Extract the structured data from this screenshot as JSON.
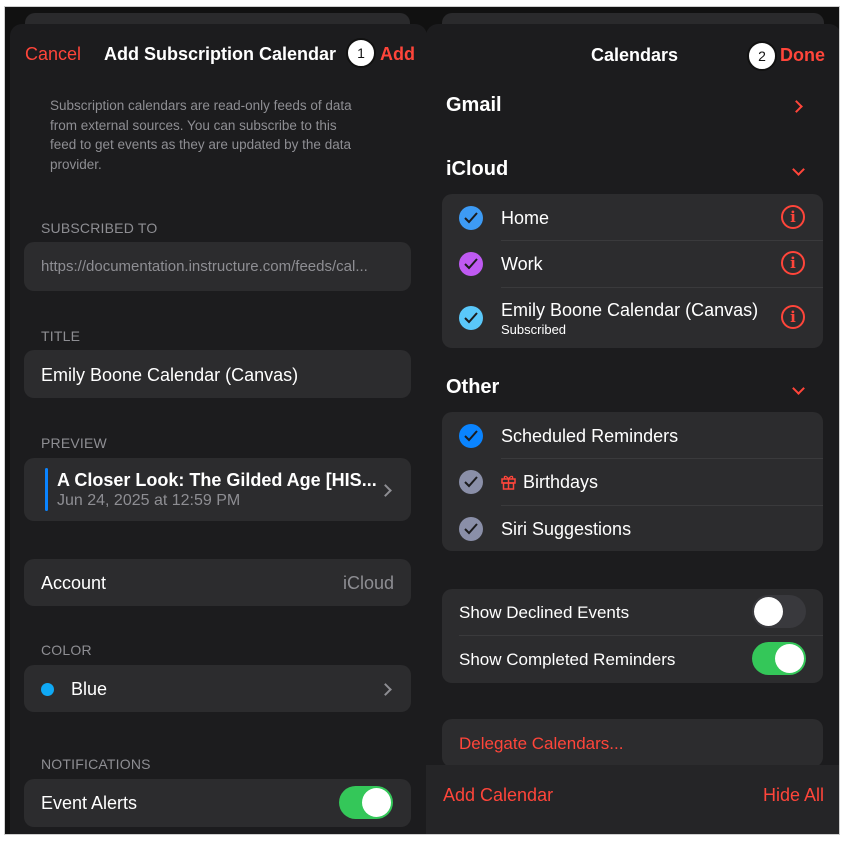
{
  "left": {
    "header": {
      "cancel_label": "Cancel",
      "title": "Add Subscription Calendar",
      "add_label": "Add",
      "step_badge": "1"
    },
    "description": [
      "Subscription calendars are read-only feeds of data",
      "from external sources. You can subscribe to this",
      "feed to get events as they are updated by the data",
      "provider."
    ],
    "subscribed_to": {
      "label": "SUBSCRIBED TO",
      "value": "https://documentation.instructure.com/feeds/cal..."
    },
    "title_section": {
      "label": "TITLE",
      "value": "Emily Boone Calendar (Canvas)"
    },
    "preview": {
      "label": "PREVIEW",
      "event_title": "A Closer Look: The Gilded Age [HIS...",
      "event_time": "Jun 24, 2025 at 12:59 PM",
      "accent": "#0a84ff"
    },
    "account": {
      "label": "Account",
      "value": "iCloud"
    },
    "color": {
      "label": "COLOR",
      "value": "Blue",
      "swatch": "#0fa9f5"
    },
    "notifications": {
      "label": "NOTIFICATIONS",
      "event_alerts_label": "Event Alerts",
      "event_alerts_on": true
    }
  },
  "right": {
    "header": {
      "title": "Calendars",
      "done_label": "Done",
      "step_badge": "2"
    },
    "gmail": {
      "label": "Gmail"
    },
    "icloud": {
      "label": "iCloud",
      "items": [
        {
          "label": "Home",
          "color": "#3d9bf5"
        },
        {
          "label": "Work",
          "color": "#bf5af2"
        },
        {
          "label": "Emily Boone Calendar (Canvas)",
          "sublabel": "Subscribed",
          "color": "#5ac8fa"
        }
      ]
    },
    "other": {
      "label": "Other",
      "items": [
        {
          "label": "Scheduled Reminders",
          "color": "#0a84ff"
        },
        {
          "label": "Birthdays",
          "color": "#8a8fa8",
          "icon": "gift-icon"
        },
        {
          "label": "Siri Suggestions",
          "color": "#8a8fa8"
        }
      ]
    },
    "toggles": [
      {
        "label": "Show Declined Events",
        "on": false
      },
      {
        "label": "Show Completed Reminders",
        "on": true
      }
    ],
    "delegate_label": "Delegate Calendars...",
    "footer": {
      "add_calendar_label": "Add Calendar",
      "hide_all_label": "Hide All"
    }
  }
}
